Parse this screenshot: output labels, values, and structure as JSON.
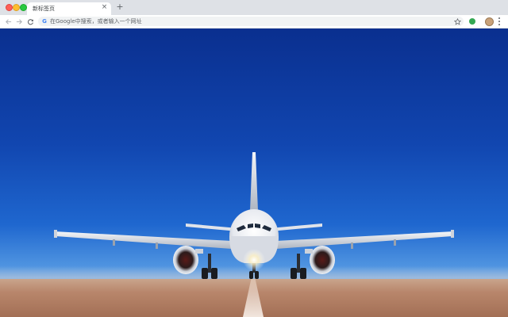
{
  "window": {
    "traffic_lights": [
      "close",
      "minimize",
      "maximize"
    ]
  },
  "tabs": [
    {
      "title": "新标签页",
      "close_icon": "close-icon"
    }
  ],
  "new_tab_icon": "plus-icon",
  "toolbar": {
    "back_icon": "arrow-left-icon",
    "forward_icon": "arrow-right-icon",
    "reload_icon": "reload-icon",
    "omnibox": {
      "engine_icon": "google-g-icon",
      "engine_letter": "G",
      "placeholder": "在Google中搜索，或者输入一个网址"
    },
    "bookmark_icon": "star-icon",
    "extension_icon": "extension-icon",
    "profile_icon": "avatar-icon",
    "menu_icon": "kebab-menu-icon"
  },
  "content": {
    "background": "airplane-on-runway",
    "colors": {
      "sky_top": "#0a2f8f",
      "sky_horizon": "#8dbbe9",
      "ground": "#b8866b"
    }
  }
}
